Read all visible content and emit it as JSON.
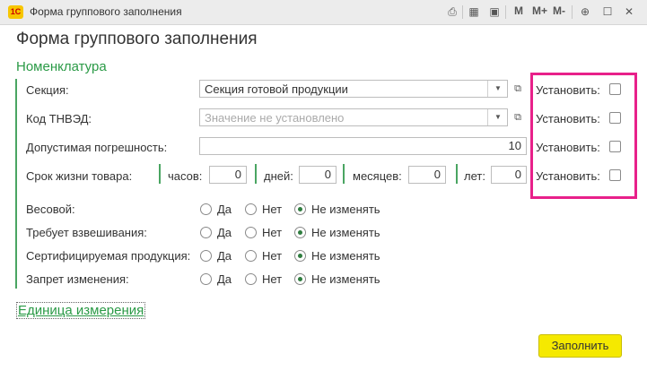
{
  "window": {
    "logo_text": "1С",
    "title": "Форма группового заполнения",
    "toolbar": {
      "m": "M",
      "m_plus": "M+",
      "m_minus": "M-"
    }
  },
  "form": {
    "title": "Форма группового заполнения",
    "group_title": "Номенклатура",
    "set_label": "Установить:",
    "section": {
      "label": "Секция:",
      "value": "Секция готовой продукции"
    },
    "tnved": {
      "label": "Код ТНВЭД:",
      "placeholder": "Значение не установлено"
    },
    "tolerance": {
      "label": "Допустимая погрешность:",
      "value": "10"
    },
    "shelf_life": {
      "label": "Срок жизни товара:",
      "hours_label": "часов:",
      "hours": "0",
      "days_label": "дней:",
      "days": "0",
      "months_label": "месяцев:",
      "months": "0",
      "years_label": "лет:",
      "years": "0"
    },
    "radio_options": {
      "yes": "Да",
      "no": "Нет",
      "keep": "Не изменять"
    },
    "radio_rows": [
      {
        "label": "Весовой:"
      },
      {
        "label": "Требует взвешивания:"
      },
      {
        "label": "Сертифицируемая продукция:"
      },
      {
        "label": "Запрет изменения:"
      }
    ],
    "unit_link": "Единица измерения",
    "fill_button": "Заполнить"
  }
}
